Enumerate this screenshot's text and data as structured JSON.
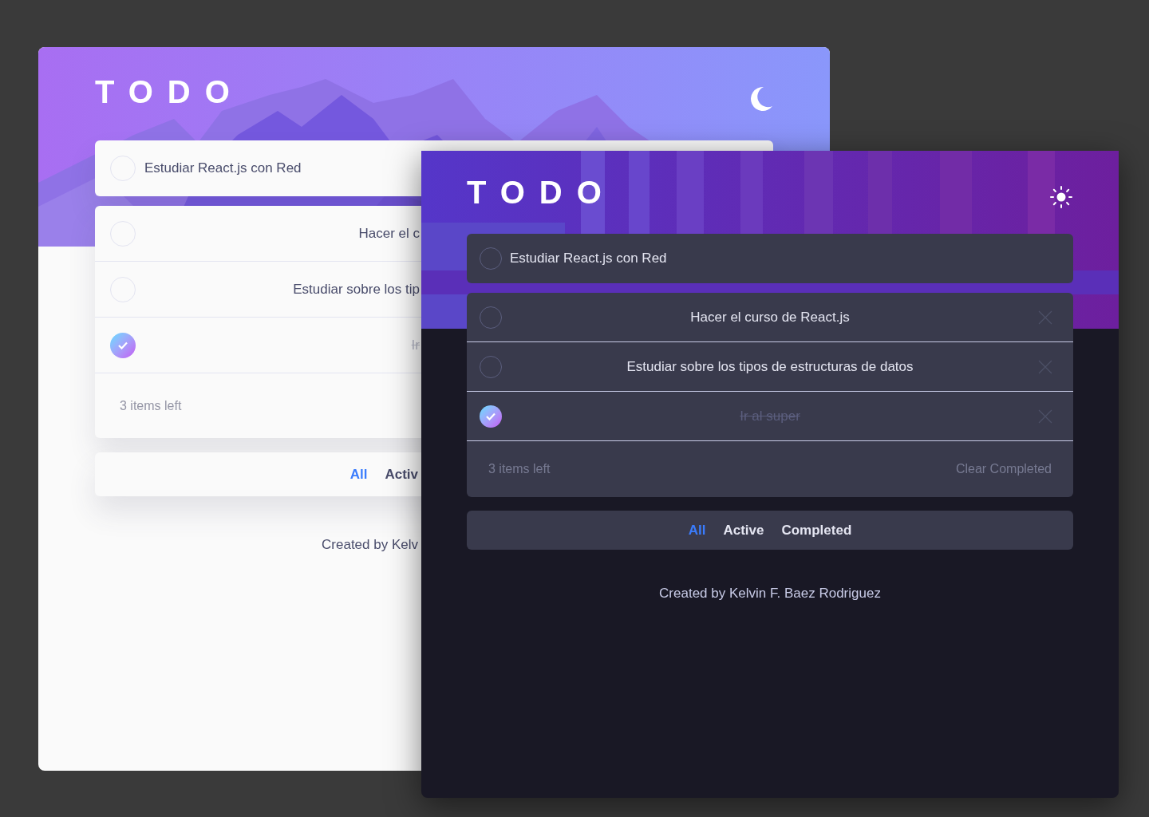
{
  "windows": [
    {
      "kind": "light",
      "title": "TODO",
      "new_todo": {
        "value": "Estudiar React.js con Red",
        "checked": false
      },
      "todos": [
        {
          "text": "Hacer el c",
          "completed": false
        },
        {
          "text": "Estudiar sobre los tip",
          "completed": false
        },
        {
          "text": "Ir",
          "completed": true
        }
      ],
      "items_left": "3 items left",
      "filters": [
        {
          "label": "All",
          "selected": true
        },
        {
          "label": "Activ",
          "selected": false
        }
      ],
      "credit": "Created by Kelv"
    },
    {
      "kind": "dark",
      "title": "TODO",
      "new_todo": {
        "value": "Estudiar React.js con Red",
        "checked": false
      },
      "todos": [
        {
          "text": "Hacer el curso de React.js",
          "completed": false
        },
        {
          "text": "Estudiar sobre los tipos de estructuras de datos",
          "completed": false
        },
        {
          "text": "Ir al super",
          "completed": true
        }
      ],
      "items_left": "3 items left",
      "clear_completed": "Clear Completed",
      "filters": [
        {
          "label": "All",
          "selected": true
        },
        {
          "label": "Active",
          "selected": false
        },
        {
          "label": "Completed",
          "selected": false
        }
      ],
      "credit": "Created by Kelvin F. Baez Rodriguez"
    }
  ]
}
